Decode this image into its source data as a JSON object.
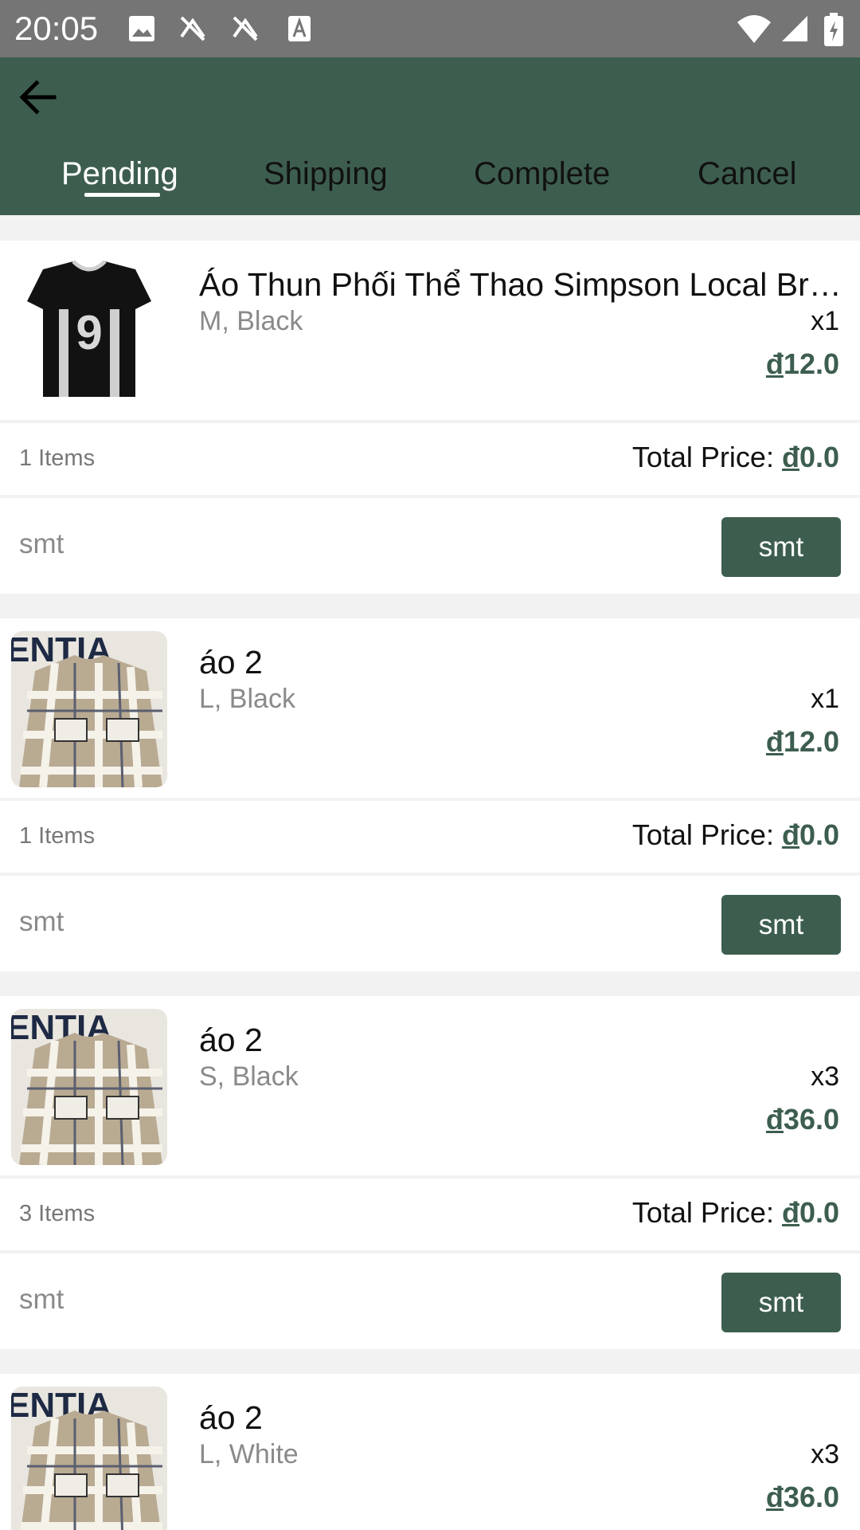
{
  "status_bar": {
    "time": "20:05"
  },
  "tabs": [
    {
      "label": "Pending",
      "active": true
    },
    {
      "label": "Shipping",
      "active": false
    },
    {
      "label": "Complete",
      "active": false
    },
    {
      "label": "Cancel",
      "active": false
    }
  ],
  "orders": [
    {
      "name": "Áo Thun Phối Thể Thao Simpson Local Br…",
      "variant": "M, Black",
      "qty": "x1",
      "price_symbol": "đ",
      "price": "12.0",
      "items": "1 Items",
      "total_label": "Total Price: ",
      "total_symbol": "đ",
      "total": "0.0",
      "action_text": "smt",
      "action_button": "smt",
      "thumb": "jersey"
    },
    {
      "name": "áo 2",
      "variant": "L, Black",
      "qty": "x1",
      "price_symbol": "đ",
      "price": "12.0",
      "items": "1 Items",
      "total_label": "Total Price: ",
      "total_symbol": "đ",
      "total": "0.0",
      "action_text": "smt",
      "action_button": "smt",
      "thumb": "plaid"
    },
    {
      "name": "áo 2",
      "variant": "S, Black",
      "qty": "x3",
      "price_symbol": "đ",
      "price": "36.0",
      "items": "3 Items",
      "total_label": "Total Price: ",
      "total_symbol": "đ",
      "total": "0.0",
      "action_text": "smt",
      "action_button": "smt",
      "thumb": "plaid"
    },
    {
      "name": "áo 2",
      "variant": "L, White",
      "qty": "x3",
      "price_symbol": "đ",
      "price": "36.0",
      "items": "",
      "total_label": "",
      "total_symbol": "",
      "total": "",
      "action_text": "",
      "action_button": "",
      "thumb": "plaid"
    }
  ],
  "colors": {
    "appbar": "#3d5e4f",
    "status_bar": "#757575",
    "accent": "#3d5e4f"
  }
}
